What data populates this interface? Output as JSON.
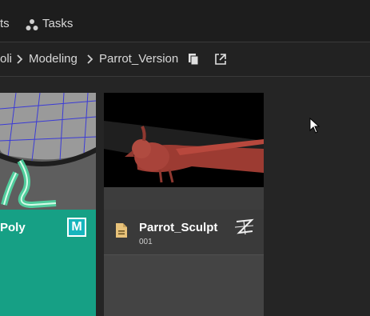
{
  "tabs": {
    "partial_label": "ts",
    "tasks_label": "Tasks"
  },
  "breadcrumb": {
    "items": [
      "oli",
      "Modeling",
      "Parrot_Version"
    ]
  },
  "cards": [
    {
      "title": "Poly",
      "app_icon": "maya-icon",
      "app_letter": "M",
      "accent": "#16a085"
    },
    {
      "title": "Parrot_Sculpt",
      "version": "001",
      "app_icon": "zbrush-icon"
    }
  ],
  "colors": {
    "background": "#222222",
    "topbar": "#1d1d1d",
    "accent_teal": "#16a085",
    "card_grey": "#444444",
    "file_icon": "#e8c27a"
  }
}
